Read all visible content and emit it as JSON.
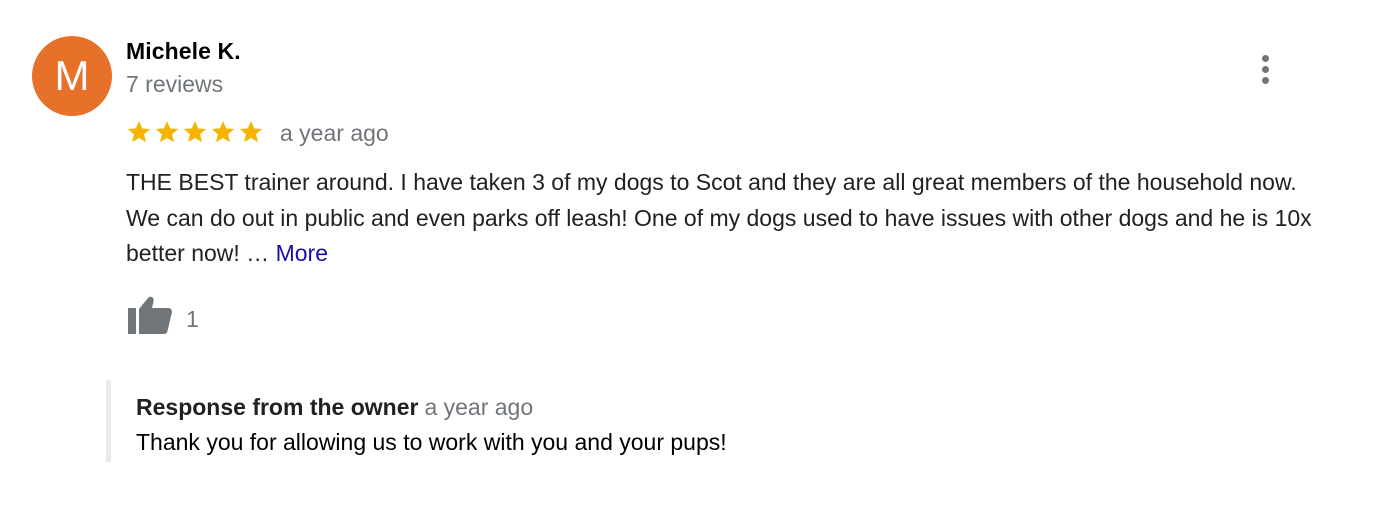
{
  "reviewer": {
    "avatar_initial": "M",
    "avatar_color": "#e8712a",
    "name": "Michele K.",
    "review_count": "7 reviews"
  },
  "menu": {
    "icon": "more-vert-icon"
  },
  "review": {
    "rating": 5,
    "rating_max": 5,
    "star_color": "#f4b400",
    "time": "a year ago",
    "text": "THE BEST trainer around. I have taken 3 of my dogs to Scot and they are all great members of the household now. We can do out in public and even parks off leash! One of my dogs used to have issues with other dogs and he is 10x better now! … ",
    "more_label": "More",
    "link_color": "#1a0dab"
  },
  "like": {
    "icon": "thumbs-up-icon",
    "count": "1"
  },
  "owner_response": {
    "label": "Response from the owner",
    "time": "a year ago",
    "text": "Thank you for allowing us to work with you and your pups!"
  }
}
